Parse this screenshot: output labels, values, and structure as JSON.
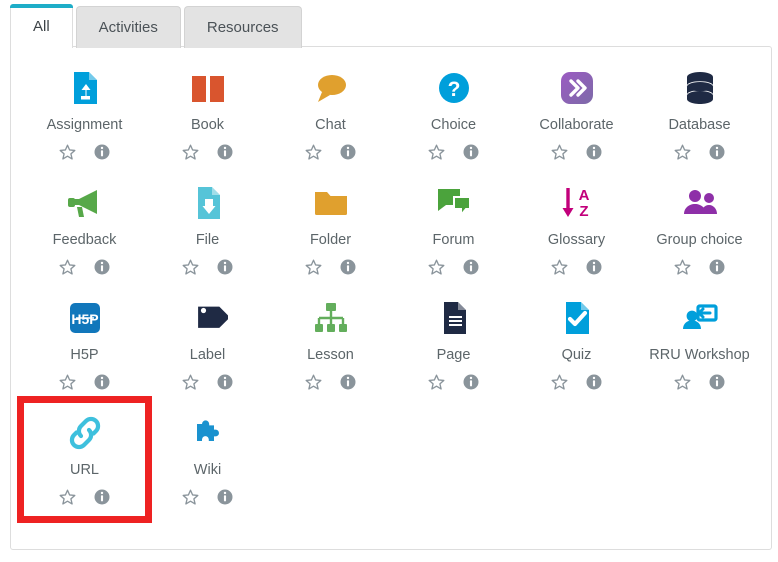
{
  "tabs": [
    {
      "label": "All",
      "active": true
    },
    {
      "label": "Activities",
      "active": false
    },
    {
      "label": "Resources",
      "active": false
    }
  ],
  "colors": {
    "active_tab_accent": "#1eadc8",
    "tab_inactive_bg": "#e3e3e3",
    "panel_border": "#dddddd",
    "label_text": "#5c6569",
    "highlight_box": "#ee2222",
    "star_outline": "#8a949b",
    "info_fill": "#8a949b"
  },
  "actions": {
    "favourite_label": "star-outline",
    "info_label": "information"
  },
  "items": [
    {
      "label": "Assignment",
      "icon": "assignment-icon",
      "color": "#009fdb",
      "highlighted": false
    },
    {
      "label": "Book",
      "icon": "book-icon",
      "color": "#d9552e",
      "highlighted": false
    },
    {
      "label": "Chat",
      "icon": "chat-icon",
      "color": "#e0a02e",
      "highlighted": false
    },
    {
      "label": "Choice",
      "icon": "choice-icon",
      "color": "#009fdb",
      "highlighted": false
    },
    {
      "label": "Collaborate",
      "icon": "collaborate-icon",
      "color": "#8a56a8",
      "highlighted": false
    },
    {
      "label": "Database",
      "icon": "database-icon",
      "color": "#1f2a44",
      "highlighted": false
    },
    {
      "label": "Feedback",
      "icon": "feedback-icon",
      "color": "#57a849",
      "highlighted": false
    },
    {
      "label": "File",
      "icon": "file-icon",
      "color": "#56c4d8",
      "highlighted": false
    },
    {
      "label": "Folder",
      "icon": "folder-icon",
      "color": "#e0a02e",
      "highlighted": false
    },
    {
      "label": "Forum",
      "icon": "forum-icon",
      "color": "#4ba33c",
      "highlighted": false
    },
    {
      "label": "Glossary",
      "icon": "glossary-icon",
      "color": "#c2007b",
      "highlighted": false
    },
    {
      "label": "Group choice",
      "icon": "group-choice-icon",
      "color": "#8e2fa8",
      "highlighted": false
    },
    {
      "label": "H5P",
      "icon": "h5p-icon",
      "color": "#1177bb",
      "highlighted": false
    },
    {
      "label": "Label",
      "icon": "label-icon",
      "color": "#1f2a44",
      "highlighted": false
    },
    {
      "label": "Lesson",
      "icon": "lesson-icon",
      "color": "#63ae5c",
      "highlighted": false
    },
    {
      "label": "Page",
      "icon": "page-icon",
      "color": "#1f2a44",
      "highlighted": false
    },
    {
      "label": "Quiz",
      "icon": "quiz-icon",
      "color": "#009fdb",
      "highlighted": false
    },
    {
      "label": "RRU Workshop",
      "icon": "rru-workshop-icon",
      "color": "#009fdb",
      "highlighted": false
    },
    {
      "label": "URL",
      "icon": "url-icon",
      "color": "#3ec0dd",
      "highlighted": true
    },
    {
      "label": "Wiki",
      "icon": "wiki-icon",
      "color": "#1a92cf",
      "highlighted": false
    }
  ]
}
